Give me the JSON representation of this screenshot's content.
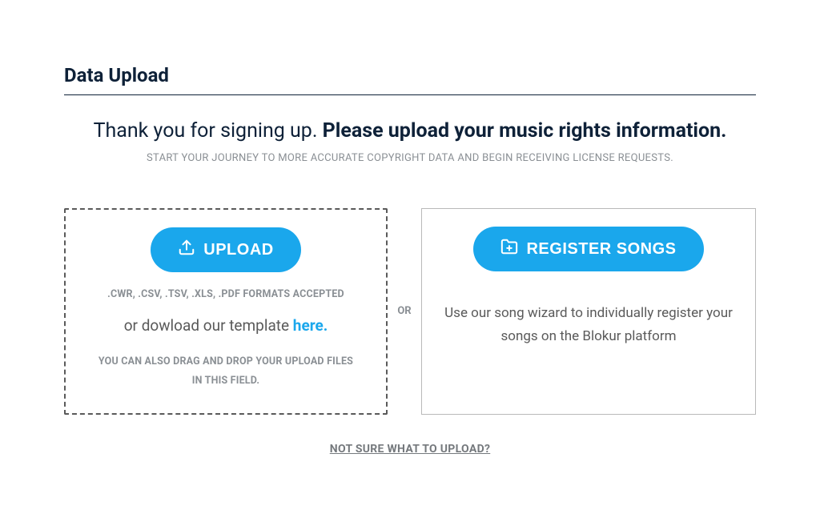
{
  "page": {
    "title": "Data Upload",
    "intro_normal": "Thank you for signing up. ",
    "intro_bold": "Please upload your music rights information.",
    "sub_intro": "START YOUR JOURNEY TO MORE ACCURATE COPYRIGHT DATA AND BEGIN RECEIVING LICENSE REQUESTS."
  },
  "upload": {
    "button_label": "UPLOAD",
    "formats": ".CWR, .CSV, .TSV, .XLS, .PDF FORMATS ACCEPTED",
    "template_text": "or dowload our template ",
    "template_link": "here.",
    "drag_text": "YOU CAN ALSO DRAG AND DROP YOUR UPLOAD FILES IN THIS FIELD."
  },
  "divider": {
    "or_label": "OR"
  },
  "register": {
    "button_label": "REGISTER SONGS",
    "description": "Use our song wizard to individually register your songs on the Blokur platform"
  },
  "footer": {
    "help_link": "NOT SURE WHAT TO UPLOAD?"
  }
}
